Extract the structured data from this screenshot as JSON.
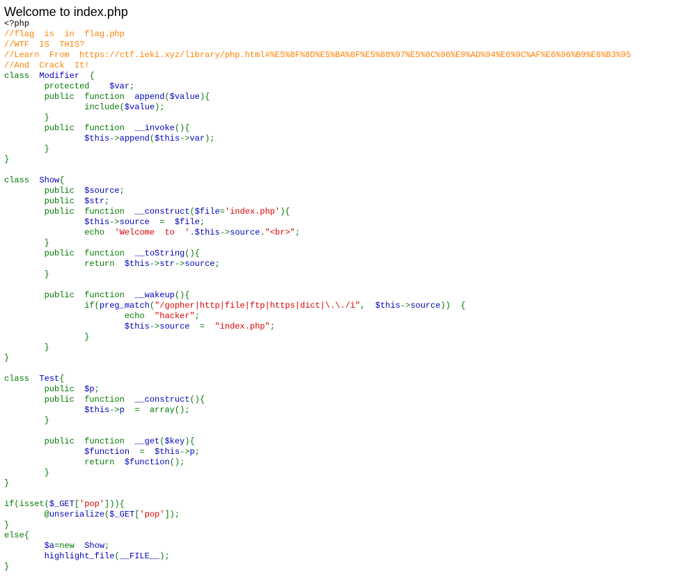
{
  "page": {
    "title": "Welcome to index.php"
  },
  "colors": {
    "default": "#0000BB",
    "keyword": "#007700",
    "comment": "#FF8000",
    "string": "#DD0000",
    "html": "#000000"
  },
  "code_lines": [
    [
      {
        "t": "html",
        "s": "<?php"
      }
    ],
    [
      {
        "t": "comment",
        "s": "//flag  is  in  flag.php"
      }
    ],
    [
      {
        "t": "comment",
        "s": "//WTF  IS  THIS?"
      }
    ],
    [
      {
        "t": "comment",
        "s": "//Learn  From  https://ctf.ieki.xyz/library/php.html#%E5%8F%8D%E5%BA%8F%E5%88%97%E5%8C%96%E9%AD%94%E6%9C%AF%E6%96%B9%E6%B3%95"
      }
    ],
    [
      {
        "t": "comment",
        "s": "//And  Crack  It!"
      }
    ],
    [
      {
        "t": "keyword",
        "s": "class  "
      },
      {
        "t": "default",
        "s": "Modifier  "
      },
      {
        "t": "keyword",
        "s": "{"
      }
    ],
    [
      {
        "t": "keyword",
        "s": "        protected    "
      },
      {
        "t": "default",
        "s": "$var"
      },
      {
        "t": "keyword",
        "s": ";"
      }
    ],
    [
      {
        "t": "keyword",
        "s": "        public  function  "
      },
      {
        "t": "default",
        "s": "append"
      },
      {
        "t": "keyword",
        "s": "("
      },
      {
        "t": "default",
        "s": "$value"
      },
      {
        "t": "keyword",
        "s": "){"
      }
    ],
    [
      {
        "t": "keyword",
        "s": "                include("
      },
      {
        "t": "default",
        "s": "$value"
      },
      {
        "t": "keyword",
        "s": ");"
      }
    ],
    [
      {
        "t": "keyword",
        "s": "        }"
      }
    ],
    [
      {
        "t": "keyword",
        "s": "        public  function  "
      },
      {
        "t": "default",
        "s": "__invoke"
      },
      {
        "t": "keyword",
        "s": "(){"
      }
    ],
    [
      {
        "t": "default",
        "s": "                $this"
      },
      {
        "t": "keyword",
        "s": "->"
      },
      {
        "t": "default",
        "s": "append"
      },
      {
        "t": "keyword",
        "s": "("
      },
      {
        "t": "default",
        "s": "$this"
      },
      {
        "t": "keyword",
        "s": "->"
      },
      {
        "t": "default",
        "s": "var"
      },
      {
        "t": "keyword",
        "s": ");"
      }
    ],
    [
      {
        "t": "keyword",
        "s": "        }"
      }
    ],
    [
      {
        "t": "keyword",
        "s": "}"
      }
    ],
    [
      {
        "t": "keyword",
        "s": ""
      }
    ],
    [
      {
        "t": "keyword",
        "s": "class  "
      },
      {
        "t": "default",
        "s": "Show"
      },
      {
        "t": "keyword",
        "s": "{"
      }
    ],
    [
      {
        "t": "keyword",
        "s": "        public  "
      },
      {
        "t": "default",
        "s": "$source"
      },
      {
        "t": "keyword",
        "s": ";"
      }
    ],
    [
      {
        "t": "keyword",
        "s": "        public  "
      },
      {
        "t": "default",
        "s": "$str"
      },
      {
        "t": "keyword",
        "s": ";"
      }
    ],
    [
      {
        "t": "keyword",
        "s": "        public  function  "
      },
      {
        "t": "default",
        "s": "__construct"
      },
      {
        "t": "keyword",
        "s": "("
      },
      {
        "t": "default",
        "s": "$file"
      },
      {
        "t": "keyword",
        "s": "="
      },
      {
        "t": "string",
        "s": "'index.php'"
      },
      {
        "t": "keyword",
        "s": "){"
      }
    ],
    [
      {
        "t": "default",
        "s": "                $this"
      },
      {
        "t": "keyword",
        "s": "->"
      },
      {
        "t": "default",
        "s": "source  "
      },
      {
        "t": "keyword",
        "s": "=  "
      },
      {
        "t": "default",
        "s": "$file"
      },
      {
        "t": "keyword",
        "s": ";"
      }
    ],
    [
      {
        "t": "keyword",
        "s": "                echo  "
      },
      {
        "t": "string",
        "s": "'Welcome  to  '"
      },
      {
        "t": "keyword",
        "s": "."
      },
      {
        "t": "default",
        "s": "$this"
      },
      {
        "t": "keyword",
        "s": "->"
      },
      {
        "t": "default",
        "s": "source"
      },
      {
        "t": "keyword",
        "s": "."
      },
      {
        "t": "string",
        "s": "\"<br>\""
      },
      {
        "t": "keyword",
        "s": ";"
      }
    ],
    [
      {
        "t": "keyword",
        "s": "        }"
      }
    ],
    [
      {
        "t": "keyword",
        "s": "        public  function  "
      },
      {
        "t": "default",
        "s": "__toString"
      },
      {
        "t": "keyword",
        "s": "(){"
      }
    ],
    [
      {
        "t": "keyword",
        "s": "                return  "
      },
      {
        "t": "default",
        "s": "$this"
      },
      {
        "t": "keyword",
        "s": "->"
      },
      {
        "t": "default",
        "s": "str"
      },
      {
        "t": "keyword",
        "s": "->"
      },
      {
        "t": "default",
        "s": "source"
      },
      {
        "t": "keyword",
        "s": ";"
      }
    ],
    [
      {
        "t": "keyword",
        "s": "        }"
      }
    ],
    [
      {
        "t": "keyword",
        "s": ""
      }
    ],
    [
      {
        "t": "keyword",
        "s": "        public  function  "
      },
      {
        "t": "default",
        "s": "__wakeup"
      },
      {
        "t": "keyword",
        "s": "(){"
      }
    ],
    [
      {
        "t": "keyword",
        "s": "                if("
      },
      {
        "t": "default",
        "s": "preg_match"
      },
      {
        "t": "keyword",
        "s": "("
      },
      {
        "t": "string",
        "s": "\"/gopher|http|file|ftp|https|dict|\\.\\./i\""
      },
      {
        "t": "keyword",
        "s": ",  "
      },
      {
        "t": "default",
        "s": "$this"
      },
      {
        "t": "keyword",
        "s": "->"
      },
      {
        "t": "default",
        "s": "source"
      },
      {
        "t": "keyword",
        "s": "))  {"
      }
    ],
    [
      {
        "t": "keyword",
        "s": "                        echo  "
      },
      {
        "t": "string",
        "s": "\"hacker\""
      },
      {
        "t": "keyword",
        "s": ";"
      }
    ],
    [
      {
        "t": "default",
        "s": "                        $this"
      },
      {
        "t": "keyword",
        "s": "->"
      },
      {
        "t": "default",
        "s": "source  "
      },
      {
        "t": "keyword",
        "s": "=  "
      },
      {
        "t": "string",
        "s": "\"index.php\""
      },
      {
        "t": "keyword",
        "s": ";"
      }
    ],
    [
      {
        "t": "keyword",
        "s": "                }"
      }
    ],
    [
      {
        "t": "keyword",
        "s": "        }"
      }
    ],
    [
      {
        "t": "keyword",
        "s": "}"
      }
    ],
    [
      {
        "t": "keyword",
        "s": ""
      }
    ],
    [
      {
        "t": "keyword",
        "s": "class  "
      },
      {
        "t": "default",
        "s": "Test"
      },
      {
        "t": "keyword",
        "s": "{"
      }
    ],
    [
      {
        "t": "keyword",
        "s": "        public  "
      },
      {
        "t": "default",
        "s": "$p"
      },
      {
        "t": "keyword",
        "s": ";"
      }
    ],
    [
      {
        "t": "keyword",
        "s": "        public  function  "
      },
      {
        "t": "default",
        "s": "__construct"
      },
      {
        "t": "keyword",
        "s": "(){"
      }
    ],
    [
      {
        "t": "default",
        "s": "                $this"
      },
      {
        "t": "keyword",
        "s": "->"
      },
      {
        "t": "default",
        "s": "p  "
      },
      {
        "t": "keyword",
        "s": "=  array();"
      }
    ],
    [
      {
        "t": "keyword",
        "s": "        }"
      }
    ],
    [
      {
        "t": "keyword",
        "s": ""
      }
    ],
    [
      {
        "t": "keyword",
        "s": "        public  function  "
      },
      {
        "t": "default",
        "s": "__get"
      },
      {
        "t": "keyword",
        "s": "("
      },
      {
        "t": "default",
        "s": "$key"
      },
      {
        "t": "keyword",
        "s": "){"
      }
    ],
    [
      {
        "t": "default",
        "s": "                $function  "
      },
      {
        "t": "keyword",
        "s": "=  "
      },
      {
        "t": "default",
        "s": "$this"
      },
      {
        "t": "keyword",
        "s": "->"
      },
      {
        "t": "default",
        "s": "p"
      },
      {
        "t": "keyword",
        "s": ";"
      }
    ],
    [
      {
        "t": "keyword",
        "s": "                return  "
      },
      {
        "t": "default",
        "s": "$function"
      },
      {
        "t": "keyword",
        "s": "();"
      }
    ],
    [
      {
        "t": "keyword",
        "s": "        }"
      }
    ],
    [
      {
        "t": "keyword",
        "s": "}"
      }
    ],
    [
      {
        "t": "keyword",
        "s": ""
      }
    ],
    [
      {
        "t": "keyword",
        "s": "if(isset("
      },
      {
        "t": "default",
        "s": "$_GET"
      },
      {
        "t": "keyword",
        "s": "["
      },
      {
        "t": "string",
        "s": "'pop'"
      },
      {
        "t": "keyword",
        "s": "])){"
      }
    ],
    [
      {
        "t": "keyword",
        "s": "        @"
      },
      {
        "t": "default",
        "s": "unserialize"
      },
      {
        "t": "keyword",
        "s": "("
      },
      {
        "t": "default",
        "s": "$_GET"
      },
      {
        "t": "keyword",
        "s": "["
      },
      {
        "t": "string",
        "s": "'pop'"
      },
      {
        "t": "keyword",
        "s": "]);"
      }
    ],
    [
      {
        "t": "keyword",
        "s": "}"
      }
    ],
    [
      {
        "t": "keyword",
        "s": "else{"
      }
    ],
    [
      {
        "t": "default",
        "s": "        $a"
      },
      {
        "t": "keyword",
        "s": "=new  "
      },
      {
        "t": "default",
        "s": "Show"
      },
      {
        "t": "keyword",
        "s": ";"
      }
    ],
    [
      {
        "t": "default",
        "s": "        highlight_file"
      },
      {
        "t": "keyword",
        "s": "("
      },
      {
        "t": "default",
        "s": "__FILE__"
      },
      {
        "t": "keyword",
        "s": ");"
      }
    ],
    [
      {
        "t": "keyword",
        "s": "}"
      }
    ]
  ]
}
